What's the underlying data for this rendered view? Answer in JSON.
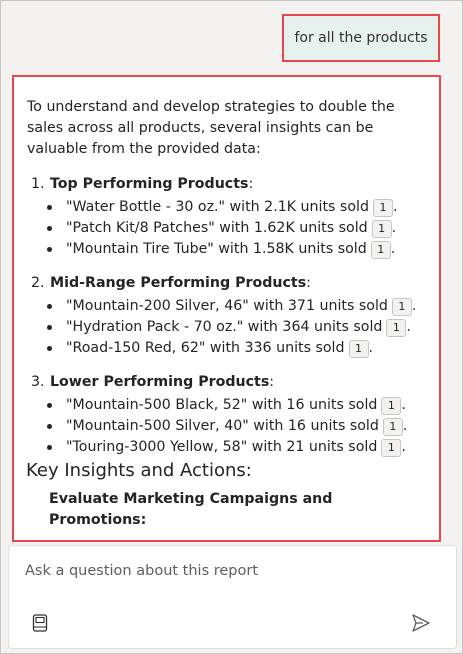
{
  "user_message": "for all the products",
  "response": {
    "intro": "To understand and develop strategies to double the sales across all products, several insights can be valuable from the provided data:",
    "sections": [
      {
        "num": "1.",
        "title": "Top Performing Products",
        "suffix": ":",
        "items": [
          {
            "text": "\"Water Bottle - 30 oz.\" with 2.1K units sold",
            "cite": "1",
            "tail": "."
          },
          {
            "text": "\"Patch Kit/8 Patches\" with 1.62K units sold",
            "cite": "1",
            "tail": "."
          },
          {
            "text": "\"Mountain Tire Tube\" with 1.58K units sold",
            "cite": "1",
            "tail": "."
          }
        ]
      },
      {
        "num": "2.",
        "title": "Mid-Range Performing Products",
        "suffix": ":",
        "items": [
          {
            "text": "\"Mountain-200 Silver, 46\" with 371 units sold",
            "cite": "1",
            "tail": "."
          },
          {
            "text": "\"Hydration Pack - 70 oz.\" with 364 units sold",
            "cite": "1",
            "tail": "."
          },
          {
            "text": "\"Road-150 Red, 62\" with 336 units sold",
            "cite": "1",
            "tail": "."
          }
        ]
      },
      {
        "num": "3.",
        "title": "Lower Performing Products",
        "suffix": ":",
        "items": [
          {
            "text": "\"Mountain-500 Black, 52\" with 16 units sold",
            "cite": "1",
            "tail": "."
          },
          {
            "text": "\"Mountain-500 Silver, 40\" with 16 units sold",
            "cite": "1",
            "tail": "."
          },
          {
            "text": "\"Touring-3000 Yellow, 58\" with 21 units sold",
            "cite": "1",
            "tail": "."
          }
        ]
      }
    ],
    "key_heading": "Key Insights and Actions:",
    "cut_line": "Evaluate Marketing Campaigns and Promotions:"
  },
  "input": {
    "placeholder": "Ask a question about this report"
  },
  "icons": {
    "left": "book-icon",
    "right": "send-icon"
  },
  "colors": {
    "highlight_border": "#e8474d",
    "user_bubble": "#e6f2ed"
  }
}
